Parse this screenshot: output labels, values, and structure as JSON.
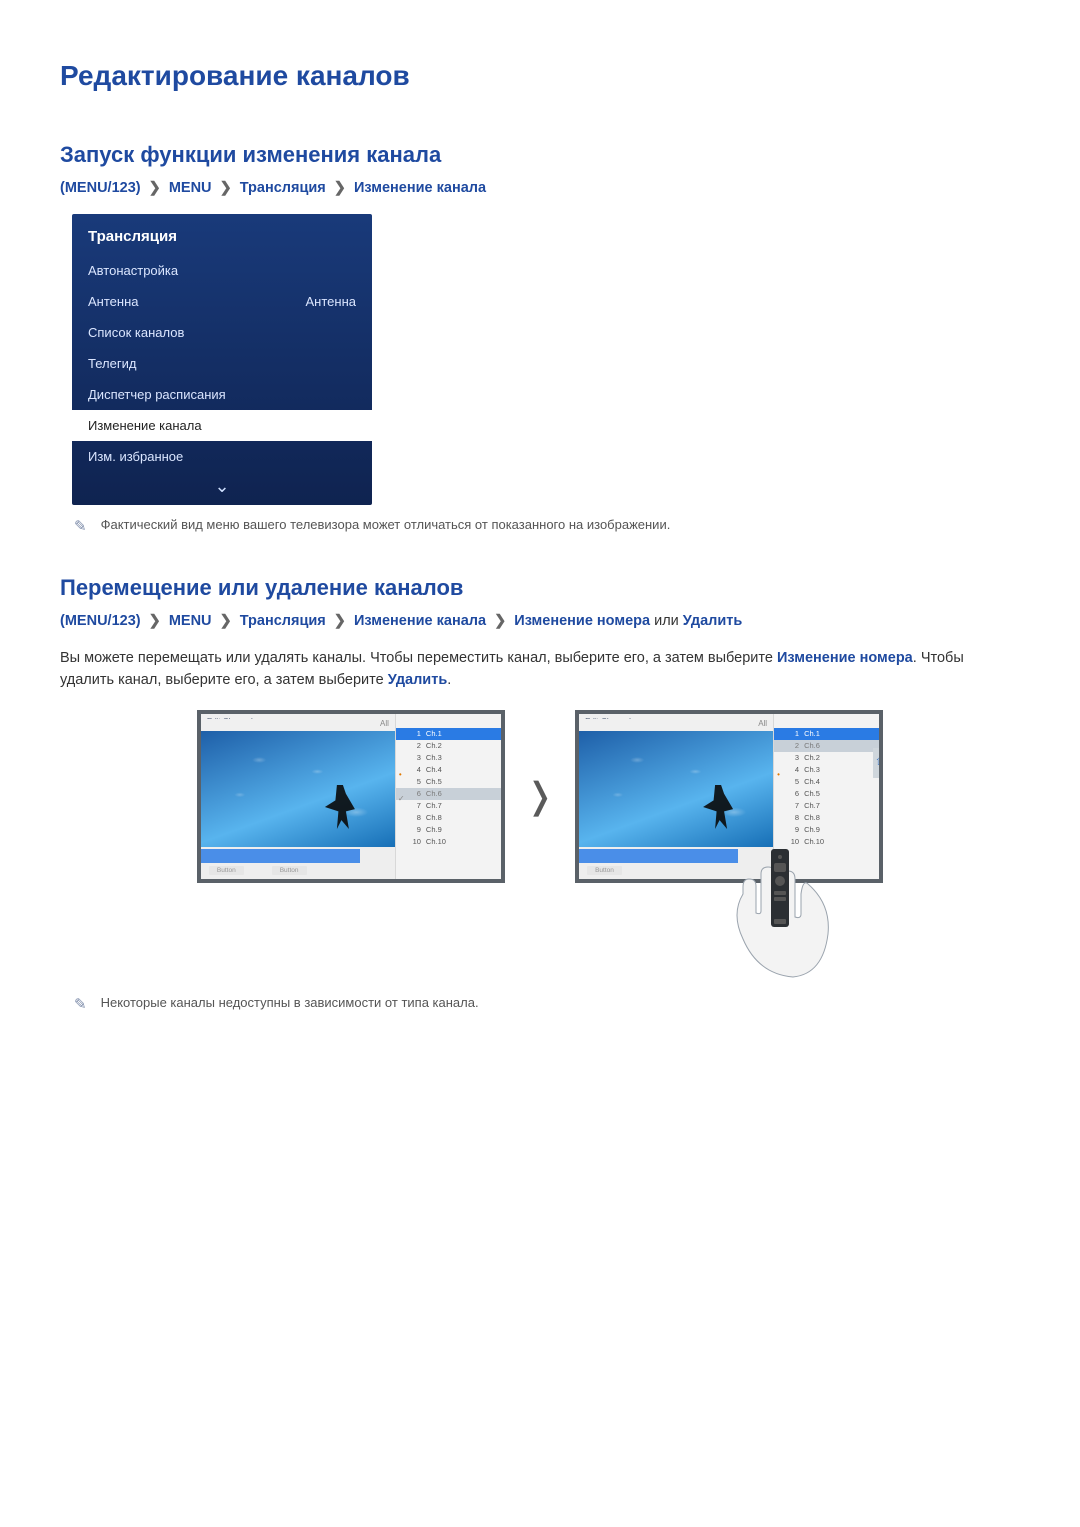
{
  "page": {
    "title": "Редактирование каналов"
  },
  "section1": {
    "heading": "Запуск функции изменения канала",
    "bc": {
      "p_open": "(",
      "menu123": "MENU/123",
      "p_close": ")",
      "menu": "MENU",
      "a": "Трансляция",
      "b": "Изменение канала"
    },
    "menu": {
      "title": "Трансляция",
      "items": [
        {
          "label": "Автонастройка",
          "value": ""
        },
        {
          "label": "Антенна",
          "value": "Антенна"
        },
        {
          "label": "Список каналов",
          "value": ""
        },
        {
          "label": "Телегид",
          "value": ""
        },
        {
          "label": "Диспетчер расписания",
          "value": ""
        },
        {
          "label": "Изменение канала",
          "value": "",
          "selected": true
        },
        {
          "label": "Изм. избранное",
          "value": ""
        }
      ]
    },
    "note": "Фактический вид меню вашего телевизора может отличаться от показанного на изображении."
  },
  "section2": {
    "heading": "Перемещение или удаление каналов",
    "bc": {
      "p_open": "(",
      "menu123": "MENU/123",
      "p_close": ")",
      "menu": "MENU",
      "a": "Трансляция",
      "b": "Изменение канала",
      "c": "Изменение номера",
      "or": " или ",
      "d": "Удалить"
    },
    "body": {
      "t1": "Вы можете перемещать или удалять каналы. Чтобы переместить канал, выберите его, а затем выберите ",
      "kw1": "Изменение номера",
      "t2": ". Чтобы удалить канал, выберите его, а затем выберите ",
      "kw2": "Удалить",
      "t3": "."
    },
    "screens": {
      "header": "Edit Channel",
      "all": "All",
      "left": {
        "buttons": [
          "Button",
          "Button"
        ],
        "channels": [
          {
            "n": "1",
            "name": "Ch.1",
            "style": "sel-blue"
          },
          {
            "n": "2",
            "name": "Ch.2"
          },
          {
            "n": "3",
            "name": "Ch.3"
          },
          {
            "n": "4",
            "name": "Ch.4",
            "mark": "dot"
          },
          {
            "n": "5",
            "name": "Ch.5"
          },
          {
            "n": "6",
            "name": "Ch.6",
            "style": "sel-gray",
            "mark": "check"
          },
          {
            "n": "7",
            "name": "Ch.7"
          },
          {
            "n": "8",
            "name": "Ch.8"
          },
          {
            "n": "9",
            "name": "Ch.9"
          },
          {
            "n": "10",
            "name": "Ch.10"
          }
        ]
      },
      "right": {
        "buttons": [
          "Button"
        ],
        "channels": [
          {
            "n": "1",
            "name": "Ch.1",
            "style": "sel-blue"
          },
          {
            "n": "2",
            "name": "Ch.6",
            "style": "sel-gray"
          },
          {
            "n": "3",
            "name": "Ch.2"
          },
          {
            "n": "4",
            "name": "Ch.3",
            "mark": "dot"
          },
          {
            "n": "5",
            "name": "Ch.4"
          },
          {
            "n": "6",
            "name": "Ch.5"
          },
          {
            "n": "7",
            "name": "Ch.7"
          },
          {
            "n": "8",
            "name": "Ch.8"
          },
          {
            "n": "9",
            "name": "Ch.9"
          },
          {
            "n": "10",
            "name": "Ch.10"
          }
        ],
        "up_arrow": true
      }
    },
    "note": "Некоторые каналы недоступны в зависимости от типа канала."
  }
}
